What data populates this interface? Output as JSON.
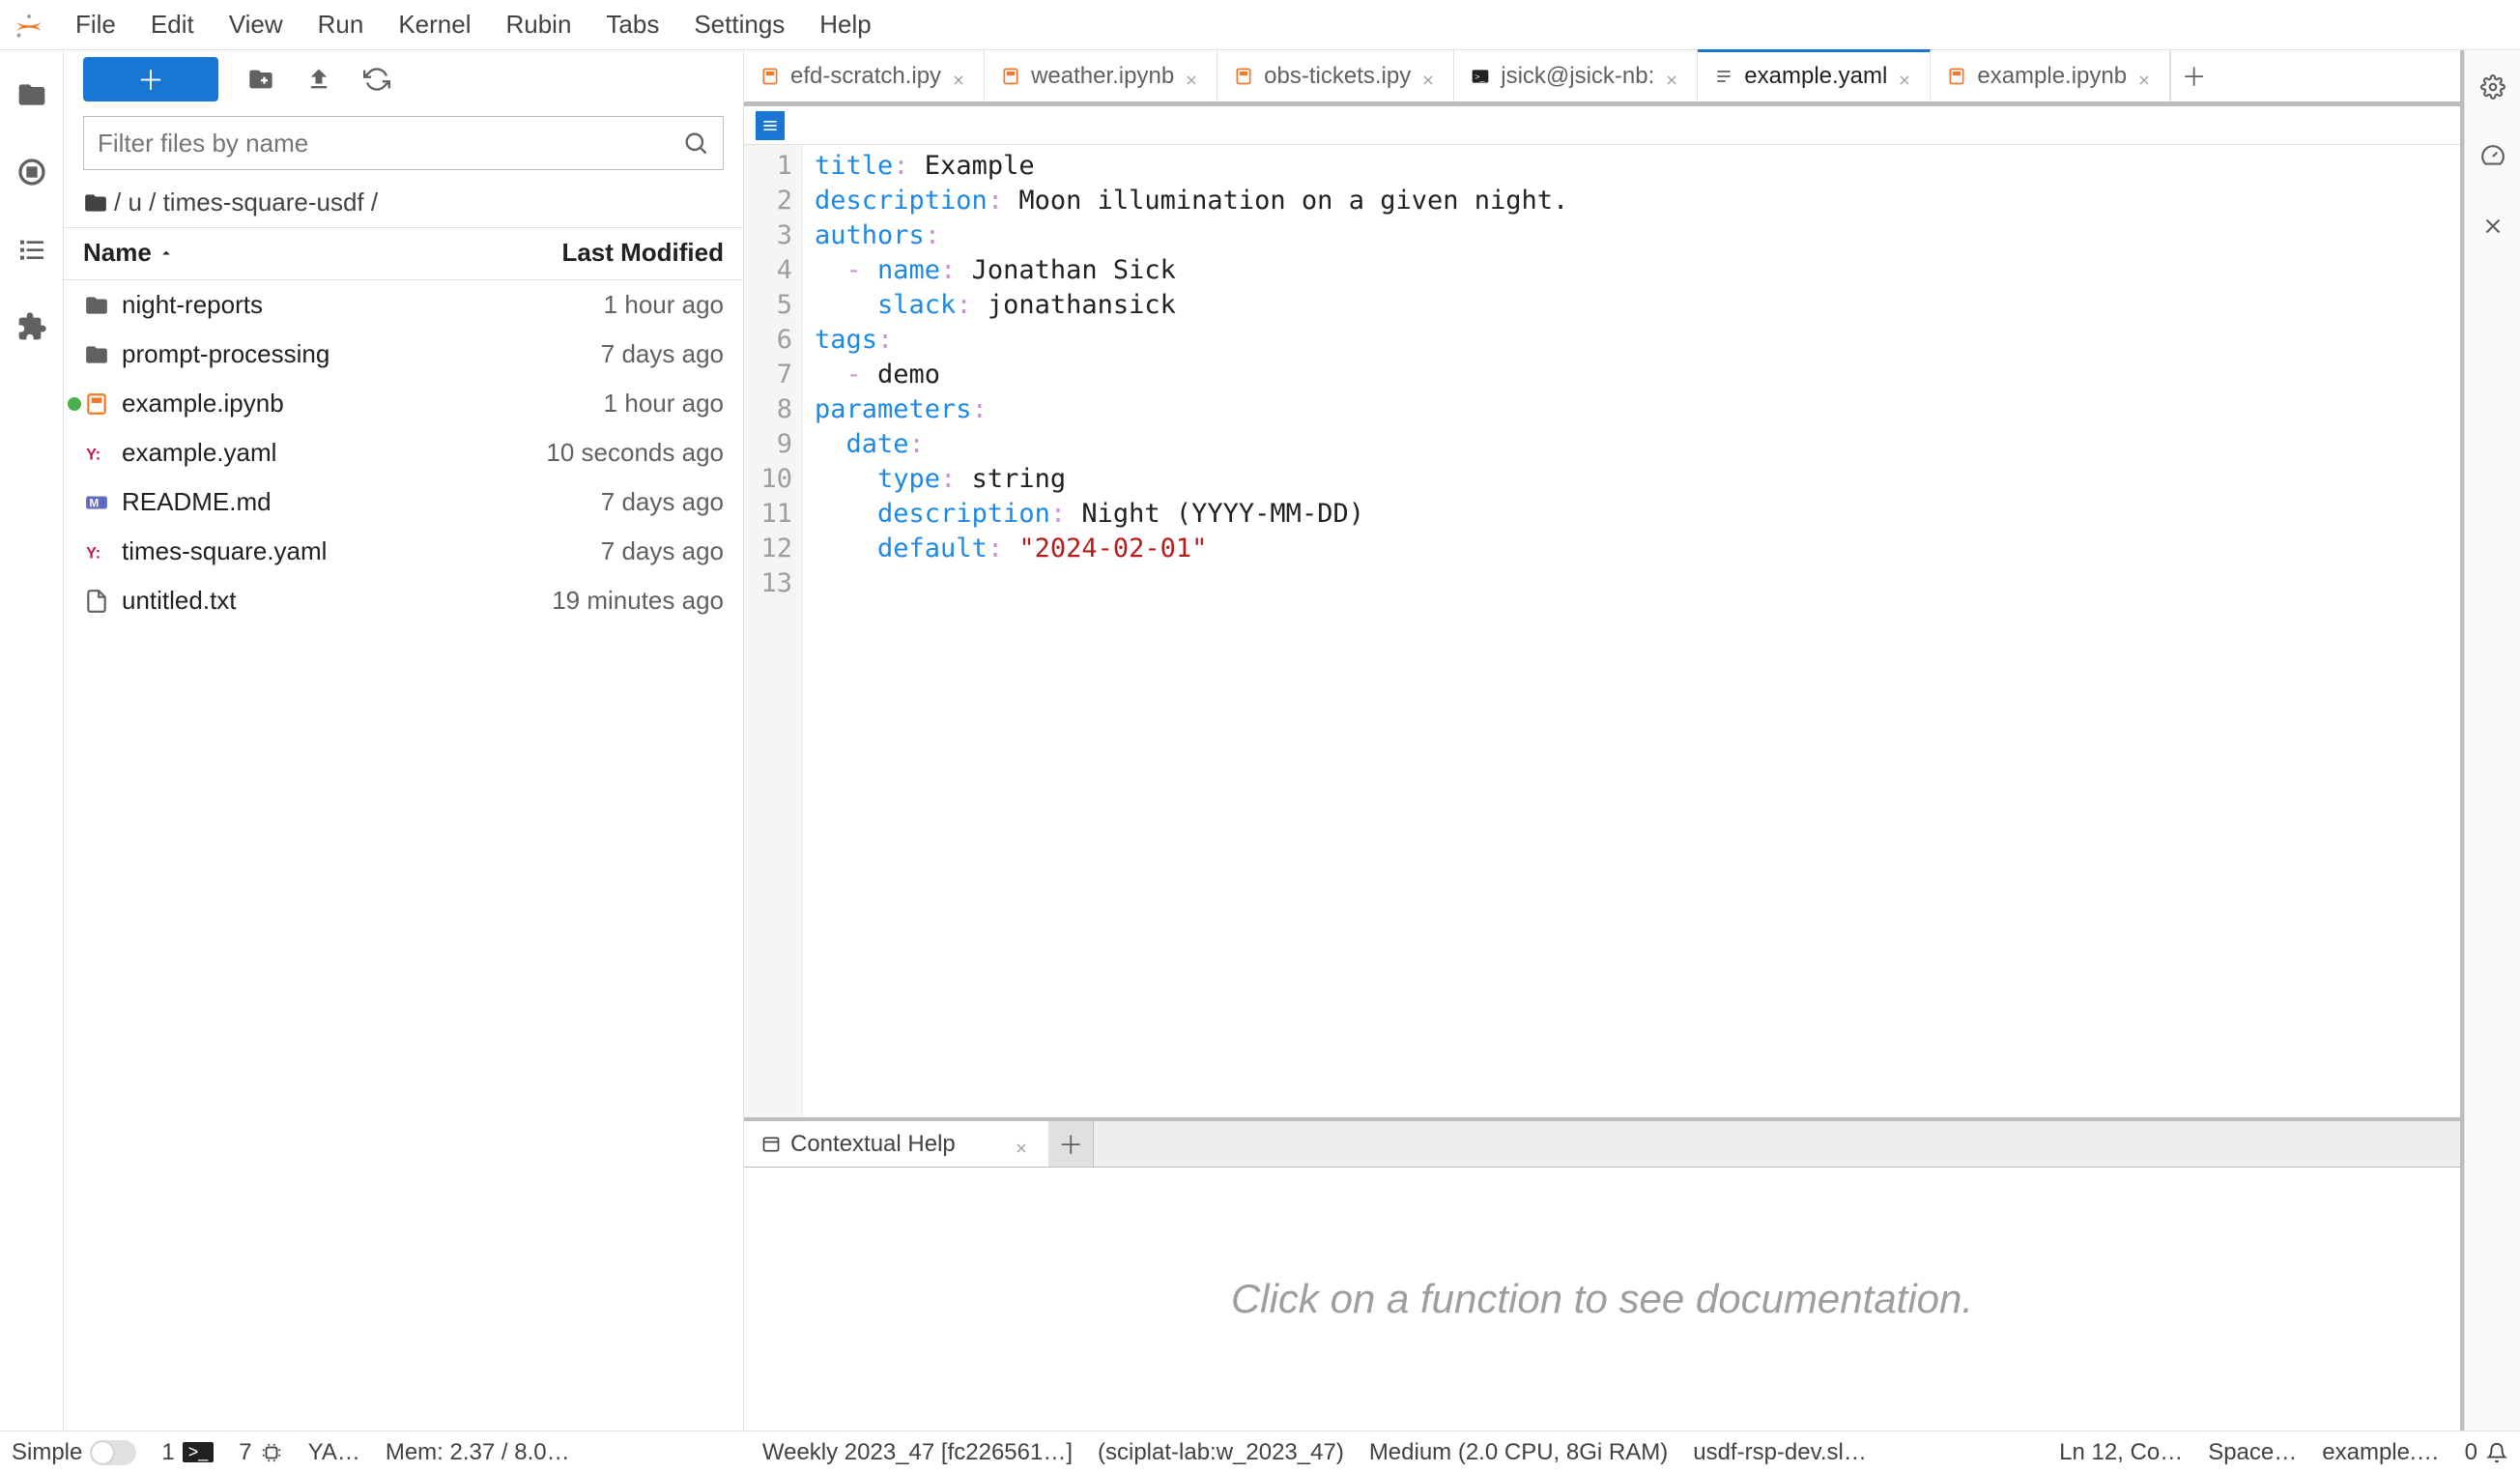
{
  "menu": [
    "File",
    "Edit",
    "View",
    "Run",
    "Kernel",
    "Rubin",
    "Tabs",
    "Settings",
    "Help"
  ],
  "filebrowser": {
    "search_placeholder": "Filter files by name",
    "breadcrumb": "/ u / times-square-usdf /",
    "cols": {
      "name": "Name",
      "modified": "Last Modified"
    },
    "files": [
      {
        "icon": "folder",
        "name": "night-reports",
        "mod": "1 hour ago"
      },
      {
        "icon": "folder",
        "name": "prompt-processing",
        "mod": "7 days ago"
      },
      {
        "icon": "notebook",
        "name": "example.ipynb",
        "mod": "1 hour ago",
        "running": true
      },
      {
        "icon": "yaml",
        "name": "example.yaml",
        "mod": "10 seconds ago"
      },
      {
        "icon": "markdown",
        "name": "README.md",
        "mod": "7 days ago"
      },
      {
        "icon": "yaml",
        "name": "times-square.yaml",
        "mod": "7 days ago"
      },
      {
        "icon": "file",
        "name": "untitled.txt",
        "mod": "19 minutes ago"
      }
    ]
  },
  "tabs": [
    {
      "icon": "notebook",
      "label": "efd-scratch.ipy"
    },
    {
      "icon": "notebook",
      "label": "weather.ipynb"
    },
    {
      "icon": "notebook",
      "label": "obs-tickets.ipy"
    },
    {
      "icon": "terminal",
      "label": "jsick@jsick-nb:"
    },
    {
      "icon": "yaml-doc",
      "label": "example.yaml",
      "active": true
    },
    {
      "icon": "notebook",
      "label": "example.ipynb"
    }
  ],
  "editor": {
    "lines": [
      [
        [
          "key",
          "title"
        ],
        [
          "punc",
          ":"
        ],
        [
          "txt",
          " Example"
        ]
      ],
      [
        [
          "key",
          "description"
        ],
        [
          "punc",
          ":"
        ],
        [
          "txt",
          " Moon illumination on a given night."
        ]
      ],
      [
        [
          "key",
          "authors"
        ],
        [
          "punc",
          ":"
        ]
      ],
      [
        [
          "txt",
          "  "
        ],
        [
          "dash",
          "- "
        ],
        [
          "sub",
          "name"
        ],
        [
          "punc",
          ":"
        ],
        [
          "txt",
          " Jonathan Sick"
        ]
      ],
      [
        [
          "txt",
          "    "
        ],
        [
          "sub",
          "slack"
        ],
        [
          "punc",
          ":"
        ],
        [
          "txt",
          " jonathansick"
        ]
      ],
      [
        [
          "key",
          "tags"
        ],
        [
          "punc",
          ":"
        ]
      ],
      [
        [
          "txt",
          "  "
        ],
        [
          "dash",
          "- "
        ],
        [
          "txt",
          "demo"
        ]
      ],
      [
        [
          "key",
          "parameters"
        ],
        [
          "punc",
          ":"
        ]
      ],
      [
        [
          "txt",
          "  "
        ],
        [
          "sub",
          "date"
        ],
        [
          "punc",
          ":"
        ]
      ],
      [
        [
          "txt",
          "    "
        ],
        [
          "sub",
          "type"
        ],
        [
          "punc",
          ":"
        ],
        [
          "txt",
          " string"
        ]
      ],
      [
        [
          "txt",
          "    "
        ],
        [
          "sub",
          "description"
        ],
        [
          "punc",
          ":"
        ],
        [
          "txt",
          " Night (YYYY-MM-DD)"
        ]
      ],
      [
        [
          "txt",
          "    "
        ],
        [
          "sub",
          "default"
        ],
        [
          "punc",
          ":"
        ],
        [
          "txt",
          " "
        ],
        [
          "str",
          "\"2024-02-01\""
        ]
      ],
      [
        [
          "txt",
          ""
        ]
      ]
    ]
  },
  "help": {
    "tab_label": "Contextual Help",
    "body": "Click on a function to see documentation."
  },
  "status": {
    "simple": "Simple",
    "term_count": "1",
    "kernel_count": "7",
    "lang": "YA…",
    "mem": "Mem: 2.37 / 8.0…",
    "image": "Weekly 2023_47 [fc226561…]",
    "container": "(sciplat-lab:w_2023_47)",
    "machine": "Medium (2.0 CPU, 8Gi RAM)",
    "host": "usdf-rsp-dev.sl…",
    "cursor": "Ln 12, Co…",
    "indent": "Space…",
    "file": "example.…",
    "notif": "0"
  }
}
